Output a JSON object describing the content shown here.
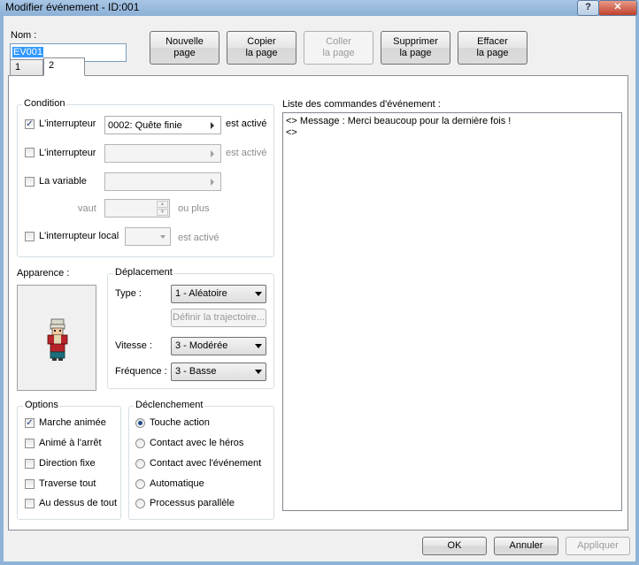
{
  "window": {
    "title": "Modifier événement - ID:001",
    "help": "?",
    "close": "✕"
  },
  "name": {
    "label": "Nom :",
    "value": "EV001"
  },
  "page_buttons": [
    {
      "line1": "Nouvelle",
      "line2": "page"
    },
    {
      "line1": "Copier",
      "line2": "la page"
    },
    {
      "line1": "Coller",
      "line2": "la page"
    },
    {
      "line1": "Supprimer",
      "line2": "la page"
    },
    {
      "line1": "Effacer",
      "line2": "la page"
    }
  ],
  "tabs": [
    "1",
    "2"
  ],
  "condition": {
    "title": "Condition",
    "switch1": {
      "label": "L'interrupteur",
      "value": "0002: Quête finie",
      "suffix": "est activé",
      "checked": true
    },
    "switch2": {
      "label": "L'interrupteur",
      "suffix": "est activé",
      "checked": false
    },
    "variable": {
      "label": "La variable",
      "checked": false
    },
    "vaut_label": "vaut",
    "ou_plus": "ou plus",
    "local_switch": {
      "label": "L'interrupteur local",
      "suffix": "est activé",
      "checked": false
    }
  },
  "appearance": {
    "label": "Apparence :",
    "sprite": "character-sprite"
  },
  "movement": {
    "title": "Déplacement",
    "type_label": "Type :",
    "type_value": "1 - Aléatoire",
    "route_button": "Définir la trajectoire...",
    "speed_label": "Vitesse :",
    "speed_value": "3 - Modérée",
    "freq_label": "Fréquence :",
    "freq_value": "3 - Basse"
  },
  "options": {
    "title": "Options",
    "items": [
      {
        "label": "Marche animée",
        "checked": true
      },
      {
        "label": "Animé à l'arrêt",
        "checked": false
      },
      {
        "label": "Direction fixe",
        "checked": false
      },
      {
        "label": "Traverse tout",
        "checked": false
      },
      {
        "label": "Au dessus de tout",
        "checked": false
      }
    ]
  },
  "trigger": {
    "title": "Déclenchement",
    "items": [
      {
        "label": "Touche action",
        "selected": true
      },
      {
        "label": "Contact avec le héros",
        "selected": false
      },
      {
        "label": "Contact avec l'événement",
        "selected": false
      },
      {
        "label": "Automatique",
        "selected": false
      },
      {
        "label": "Processus parallèle",
        "selected": false
      }
    ]
  },
  "commands": {
    "label": "Liste des commandes d'événement :",
    "lines": [
      "<> Message : Merci beaucoup pour la dernière fois !",
      "<>"
    ]
  },
  "footer": {
    "ok": "OK",
    "cancel": "Annuler",
    "apply": "Appliquer"
  },
  "colors": {
    "accent": "#3399ff",
    "titlebar": "#8fb3d6",
    "close": "#c0412b"
  }
}
